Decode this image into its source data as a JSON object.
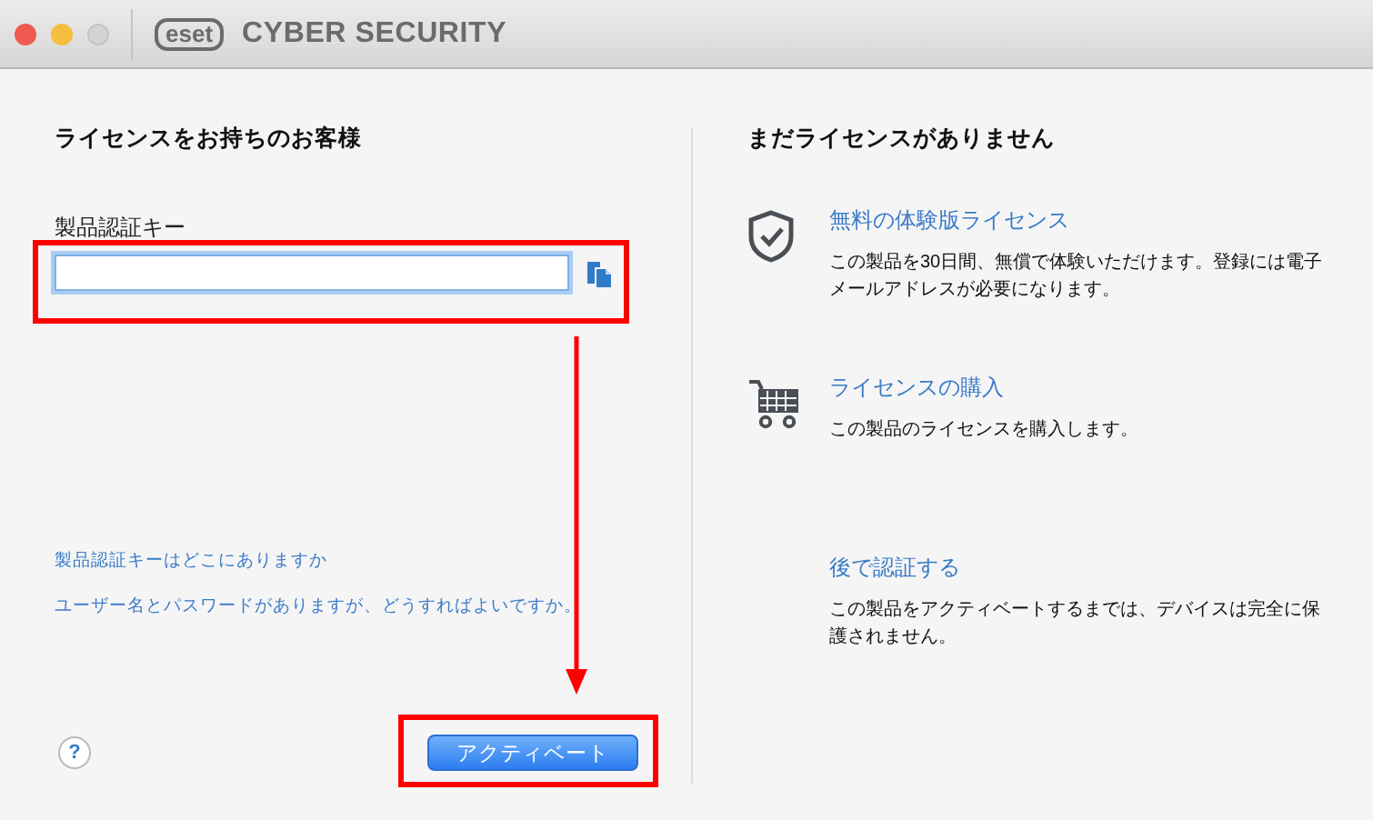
{
  "window": {
    "logo": "eset",
    "title": "CYBER SECURITY"
  },
  "left": {
    "heading": "ライセンスをお持ちのお客様",
    "field_label": "製品認証キー",
    "field_focused": true,
    "links": [
      "製品認証キーはどこにありますか",
      "ユーザー名とパスワードがありますが、どうすればよいですか。"
    ],
    "help": "?",
    "button": "アクティベート"
  },
  "right": {
    "heading": "まだライセンスがありません",
    "options": [
      {
        "kind": "shield",
        "title": "無料の体験版ライセンス",
        "description": "この製品を30日間、無償で体験いただけます。登録には電子メールアドレスが必要になります。"
      },
      {
        "kind": "cart",
        "title": "ライセンスの購入",
        "description": "この製品のライセンスを購入します。"
      },
      {
        "kind": "none",
        "title": "後で認証する",
        "description": "この製品をアクティベートするまでは、デバイスは完全に保護されません。"
      }
    ]
  }
}
